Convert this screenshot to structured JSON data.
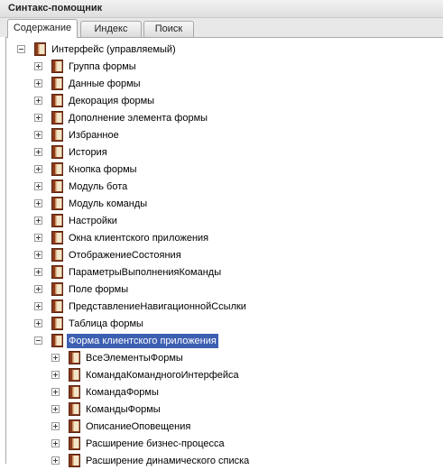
{
  "window": {
    "title": "Синтакс-помощник"
  },
  "tabs": [
    {
      "label": "Содержание",
      "active": true
    },
    {
      "label": "Индекс",
      "active": false
    },
    {
      "label": "Поиск",
      "active": false
    }
  ],
  "tree": {
    "root": {
      "label": "Интерфейс (управляемый)",
      "expanded": true
    },
    "items": [
      {
        "label": "Группа формы",
        "expanded": false
      },
      {
        "label": "Данные формы",
        "expanded": false
      },
      {
        "label": "Декорация формы",
        "expanded": false
      },
      {
        "label": "Дополнение элемента формы",
        "expanded": false
      },
      {
        "label": "Избранное",
        "expanded": false
      },
      {
        "label": "История",
        "expanded": false
      },
      {
        "label": "Кнопка формы",
        "expanded": false
      },
      {
        "label": "Модуль бота",
        "expanded": false
      },
      {
        "label": "Модуль команды",
        "expanded": false
      },
      {
        "label": "Настройки",
        "expanded": false
      },
      {
        "label": "Окна клиентского приложения",
        "expanded": false
      },
      {
        "label": "ОтображениеСостояния",
        "expanded": false
      },
      {
        "label": "ПараметрыВыполненияКоманды",
        "expanded": false
      },
      {
        "label": "Поле формы",
        "expanded": false
      },
      {
        "label": "ПредставлениеНавигационнойСсылки",
        "expanded": false
      },
      {
        "label": "Таблица формы",
        "expanded": false
      },
      {
        "label": "Форма клиентского приложения",
        "expanded": true,
        "selected": true
      }
    ],
    "children": [
      {
        "label": "ВсеЭлементыФормы"
      },
      {
        "label": "КомандаКомандногоИнтерфейса"
      },
      {
        "label": "КомандаФормы"
      },
      {
        "label": "КомандыФормы"
      },
      {
        "label": "ОписаниеОповещения"
      },
      {
        "label": "Расширение бизнес-процесса"
      },
      {
        "label": "Расширение динамического списка"
      }
    ]
  },
  "colors": {
    "selection": "#3d5fb2",
    "book_cover": "#8b3a1c",
    "book_pages": "#f3e6c8"
  },
  "icons": {
    "expand": "plus-box-icon",
    "collapse": "minus-box-icon",
    "book": "book-icon"
  }
}
